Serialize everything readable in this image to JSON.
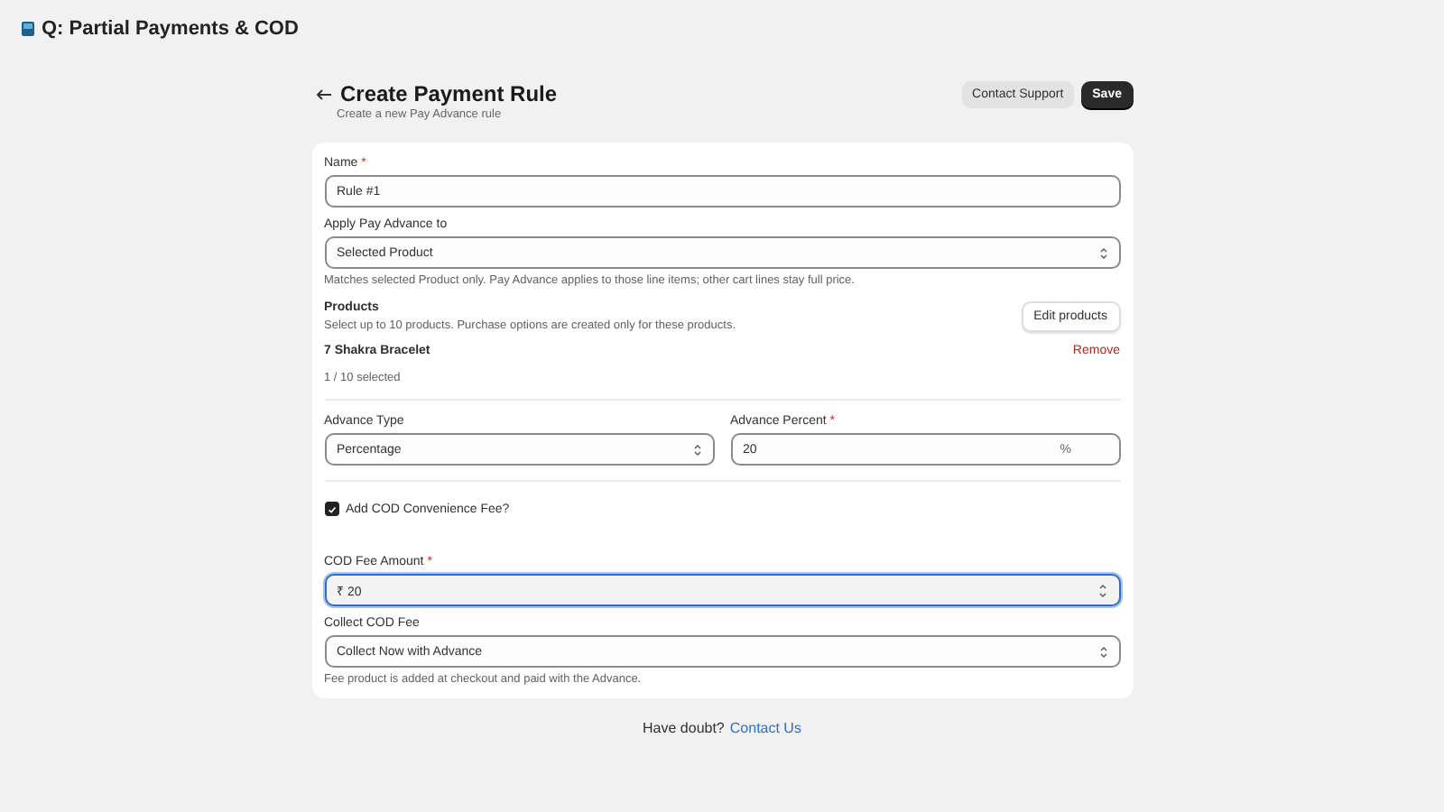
{
  "app_bar": {
    "title": "Q: Partial Payments & COD"
  },
  "header": {
    "title": "Create Payment Rule",
    "subtitle": "Create a new Pay Advance rule",
    "buttons": [
      {
        "label": "Contact Support",
        "kind": "secondary"
      },
      {
        "label": "Save",
        "kind": "primary"
      }
    ]
  },
  "form": {
    "name_field": {
      "label": "Name",
      "required_mark": "*",
      "value": "Rule #1"
    },
    "apply_field": {
      "label": "Apply Pay Advance to",
      "value": "Selected Product",
      "help": "Matches selected Product only. Pay Advance applies to those line items; other cart lines stay full price."
    },
    "products": {
      "title": "Products",
      "help": "Select up to 10 products. Purchase options are created only for these products.",
      "edit_button": "Edit products",
      "items": [
        {
          "name": "7 Shakra Bracelet",
          "remove": "Remove"
        }
      ],
      "count": "1 / 10 selected"
    },
    "advance_type": {
      "label": "Advance Type",
      "value": "Percentage"
    },
    "advance_percent": {
      "label": "Advance Percent",
      "required_mark": "*",
      "value": "20",
      "suffix": "%"
    },
    "cod_fee_checkbox": {
      "label": "Add COD Convenience Fee?",
      "checked": true
    },
    "cod_fee_amount": {
      "label": "COD Fee Amount",
      "required_mark": "*",
      "prefix": "₹",
      "value": "20",
      "focused": true
    },
    "collect_fee": {
      "label": "Collect COD Fee",
      "value": "Collect Now with Advance",
      "help": "Fee product is added at checkout and paid with the Advance."
    }
  },
  "footer": {
    "text": "Have doubt?",
    "link": "Contact Us"
  }
}
